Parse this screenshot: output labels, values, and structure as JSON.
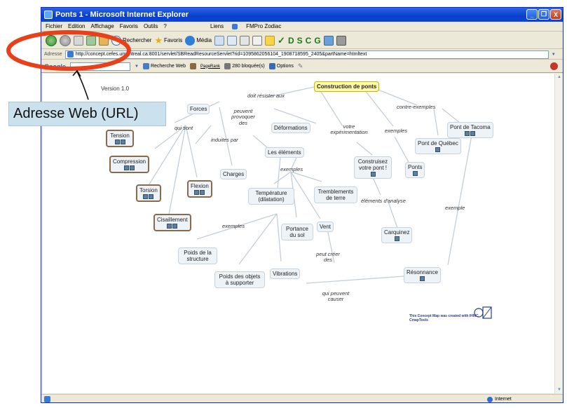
{
  "window": {
    "title": "Ponts 1 - Microsoft Internet Explorer",
    "buttons": [
      "_",
      "❐",
      "X"
    ]
  },
  "menubar": {
    "items": [
      "Fichier",
      "Edition",
      "Affichage",
      "Favoris",
      "Outils",
      "?"
    ],
    "links_label": "Liens",
    "links_item": "FMPro Zodiac"
  },
  "toolbar": {
    "search_label": "Rechercher",
    "favorites_label": "Favoris",
    "media_label": "Média",
    "letters": [
      "D",
      "S",
      "C",
      "G"
    ]
  },
  "addressbar": {
    "label": "Adresse",
    "url": "http://concept.cefes.umontreal.ca:8001/servlet/SBReadResourceServlet?rid=1095862056104_1908718595_2405&partName=htmltext"
  },
  "googlebar": {
    "brand": "Google",
    "search_web": "Recherche Web",
    "pagerank": "PageRank",
    "blocked": "280 bloquée(s)",
    "options": "Options"
  },
  "annotation": {
    "label": "Adresse Web (URL)"
  },
  "map": {
    "version": "Version 1.0",
    "credit": "This Concept Map was created with IHMC CmapTools",
    "nodes": {
      "root": "Construction de ponts",
      "forces": "Forces",
      "deformations": "Déformations",
      "tension": "Tension",
      "compression": "Compression",
      "torsion": "Torsion",
      "flexion": "Flexion",
      "cisaillement": "Cisaillement",
      "charges": "Charges",
      "elements": "Les éléments",
      "temperature": "Température (dilatation)",
      "tremblements": "Tremblements de terre",
      "portance": "Portance du sol",
      "vent": "Vent",
      "poids_structure": "Poids de la structure",
      "poids_objets": "Poids des objets à supporter",
      "vibrations": "Vibrations",
      "construisez": "Construisez votre pont !",
      "ponts": "Ponts",
      "pont_quebec": "Pont de Québec",
      "pont_tacoma": "Pont de Tacoma",
      "carquinez": "Carquinez",
      "resonnance": "Résonnance"
    },
    "links": {
      "doit_resister": "doit résister aux",
      "peuvent_provoquer": "peuvent provoquer des",
      "qui_sont": "qui sont",
      "induites_par": "induites par",
      "exemples_elements": "exemples",
      "exemples_charges": "exemples",
      "votre_experimentation": "votre expérimentation",
      "exemples_ponts": "exemples",
      "contre_exemples": "contre-exemples",
      "elements_analyse": "éléments d'analyse",
      "exemple": "exemple",
      "peut_creer": "peut créer des",
      "qui_peuvent_causer": "qui peuvent causer"
    }
  },
  "statusbar": {
    "zone": "Internet"
  },
  "colors": {
    "titlebar": "#0a3fc8",
    "highlight_ellipse": "#e8401a",
    "root_fill": "#fffaa6",
    "node_fill": "#eef3f8"
  }
}
